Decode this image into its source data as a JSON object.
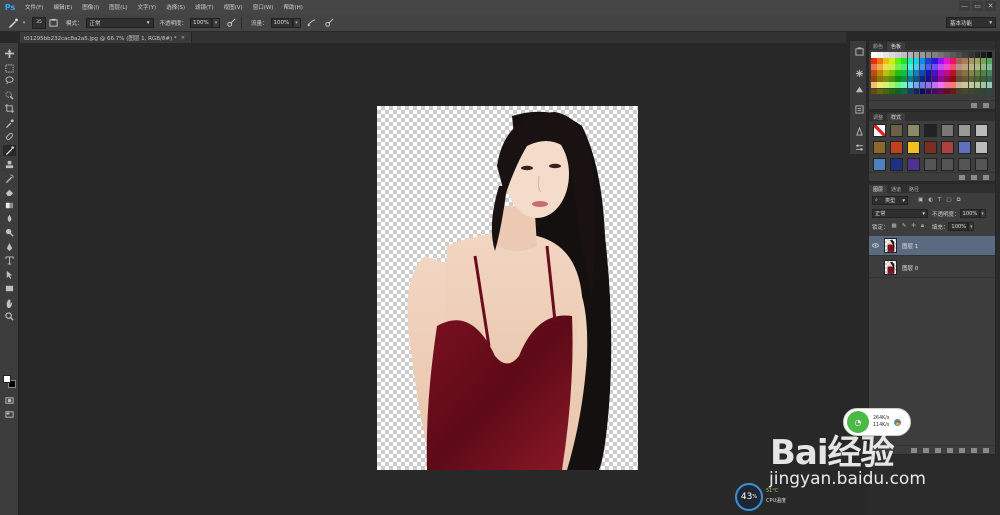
{
  "app": {
    "logo": "Ps"
  },
  "menu": [
    "文件(F)",
    "编辑(E)",
    "图像(I)",
    "图层(L)",
    "文字(Y)",
    "选择(S)",
    "滤镜(T)",
    "视图(V)",
    "窗口(W)",
    "帮助(H)"
  ],
  "window_controls": [
    "—",
    "▭",
    "✕"
  ],
  "options": {
    "brush_size": "35",
    "mode_label": "模式：",
    "mode_value": "正常",
    "opacity_label": "不透明度：",
    "opacity_value": "100%",
    "flow_label": "流量：",
    "flow_value": "100%",
    "workspace": "基本功能"
  },
  "document": {
    "tab_title": "t01295bb232cac8a2a5.jpg @ 66.7% (图层 1, RGB/8#) *"
  },
  "tools": [
    "move-icon",
    "marquee-icon",
    "lasso-icon",
    "quick-select-icon",
    "crop-icon",
    "eyedropper-icon",
    "healing-icon",
    "brush-icon",
    "stamp-icon",
    "history-brush-icon",
    "eraser-icon",
    "gradient-icon",
    "blur-icon",
    "dodge-icon",
    "pen-icon",
    "type-icon",
    "path-select-icon",
    "rectangle-icon",
    "hand-icon",
    "zoom-icon"
  ],
  "colors": {
    "foreground": "#ffffff",
    "background": "#000000",
    "accent": "#31a8ff",
    "selected_layer": "#5a6a80"
  },
  "panels": {
    "swatches": {
      "tabs": [
        "颜色",
        "色板"
      ],
      "active": 1
    },
    "styles": {
      "tabs": [
        "调整",
        "样式"
      ],
      "active": 1
    },
    "layers": {
      "tabs": [
        "图层",
        "通道",
        "路径"
      ],
      "kind_label": "类型",
      "blend_mode": "正常",
      "opacity_label": "不透明度：",
      "opacity_value": "100%",
      "lock_label": "锁定：",
      "fill_label": "填充：",
      "fill_value": "100%",
      "items": [
        {
          "name": "图层 1",
          "selected": true
        },
        {
          "name": "图层 0",
          "selected": false
        }
      ]
    }
  },
  "network_widget": {
    "up": "264K/s",
    "down": "114K/s"
  },
  "cpu_widget": {
    "percent": "43",
    "unit": "%",
    "temp": "51°C",
    "label": "CPU温度"
  },
  "watermark": {
    "brand": "Bai经验",
    "url": "jingyan.baidu.com"
  }
}
